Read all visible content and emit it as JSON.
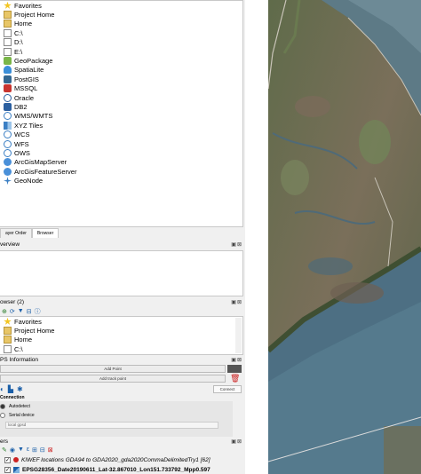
{
  "browser": {
    "items": [
      {
        "label": "Favorites",
        "icon": "star-icon"
      },
      {
        "label": "Project Home",
        "icon": "folder-icon"
      },
      {
        "label": "Home",
        "icon": "folder-icon"
      },
      {
        "label": "C:\\",
        "icon": "drive-icon"
      },
      {
        "label": "D:\\",
        "icon": "drive-icon"
      },
      {
        "label": "E:\\",
        "icon": "drive-icon"
      },
      {
        "label": "GeoPackage",
        "icon": "geopackage-icon"
      },
      {
        "label": "SpatiaLite",
        "icon": "spatialite-icon"
      },
      {
        "label": "PostGIS",
        "icon": "postgis-icon"
      },
      {
        "label": "MSSQL",
        "icon": "mssql-icon"
      },
      {
        "label": "Oracle",
        "icon": "oracle-icon"
      },
      {
        "label": "DB2",
        "icon": "db2-icon"
      },
      {
        "label": "WMS/WMTS",
        "icon": "globe-icon"
      },
      {
        "label": "XYZ Tiles",
        "icon": "tiles-icon"
      },
      {
        "label": "WCS",
        "icon": "globe-icon"
      },
      {
        "label": "WFS",
        "icon": "globe-icon"
      },
      {
        "label": "OWS",
        "icon": "globe-icon"
      },
      {
        "label": "ArcGisMapServer",
        "icon": "arcgis-icon"
      },
      {
        "label": "ArcGisFeatureServer",
        "icon": "arcgis-icon"
      },
      {
        "label": "GeoNode",
        "icon": "geonode-icon"
      }
    ]
  },
  "tabs": [
    "ayer Order",
    "Browser"
  ],
  "overview": {
    "title": "verview"
  },
  "browser2": {
    "title": "owser (2)",
    "items": [
      "Favorites",
      "Project Home",
      "Home",
      "C:\\"
    ]
  },
  "gps": {
    "title": "PS Information",
    "add_point": "Add Point",
    "add_track_point": "Add track point",
    "connect": "Connect",
    "connection_label": "Connection",
    "autodetect": "Autodetect",
    "serial_device": "Serial device",
    "local_gpsd": "local gpsd"
  },
  "layers": {
    "title": "ers",
    "items": [
      {
        "label": "KIWEF locations GDA94 to GDA2020_gda2020CommaDelimitedTry1 [62]",
        "italic": true,
        "checked": true
      },
      {
        "label": "EPSG28356_Date20190611_Lat-32.867010_Lon151.733792_Mpp0.597",
        "italic": false,
        "checked": true
      }
    ]
  },
  "colors": {
    "accent_red": "#cc2222",
    "panel_bg": "#f0f0f0"
  }
}
